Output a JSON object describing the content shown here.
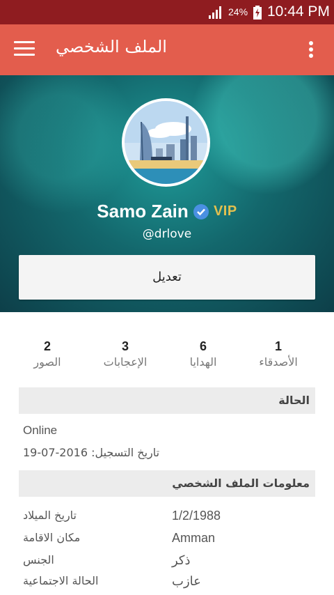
{
  "status_bar": {
    "battery": "24%",
    "time": "10:44 PM"
  },
  "app_bar": {
    "title": "الملف الشخصي",
    "menu_icon": "hamburger-icon",
    "more_icon": "more-vert-icon"
  },
  "profile": {
    "name": "Samo Zain",
    "badge": "VIP",
    "handle": "@drlove",
    "edit_label": "تعديل",
    "verified_color": "#4a90e2"
  },
  "stats": [
    {
      "count": "1",
      "label": "الأصدقاء"
    },
    {
      "count": "6",
      "label": "الهدايا"
    },
    {
      "count": "3",
      "label": "الإعجابات"
    },
    {
      "count": "2",
      "label": "الصور"
    }
  ],
  "status_section": {
    "title": "الحالة",
    "status": "Online",
    "registration": "تاريخ التسجيل: 2016-07-19"
  },
  "info_section": {
    "title": "معلومات الملف الشخصي",
    "rows": [
      {
        "label": "تاريخ الميلاد",
        "value": "1/2/1988"
      },
      {
        "label": "مكان الاقامة",
        "value": "Amman"
      },
      {
        "label": "الجنس",
        "value": "ذكر"
      },
      {
        "label": "الحالة الاجتماعية",
        "value": "عازب"
      }
    ]
  },
  "colors": {
    "status_bar": "#8f1c20",
    "app_bar": "#e35d4d",
    "vip": "#e2c04f"
  }
}
